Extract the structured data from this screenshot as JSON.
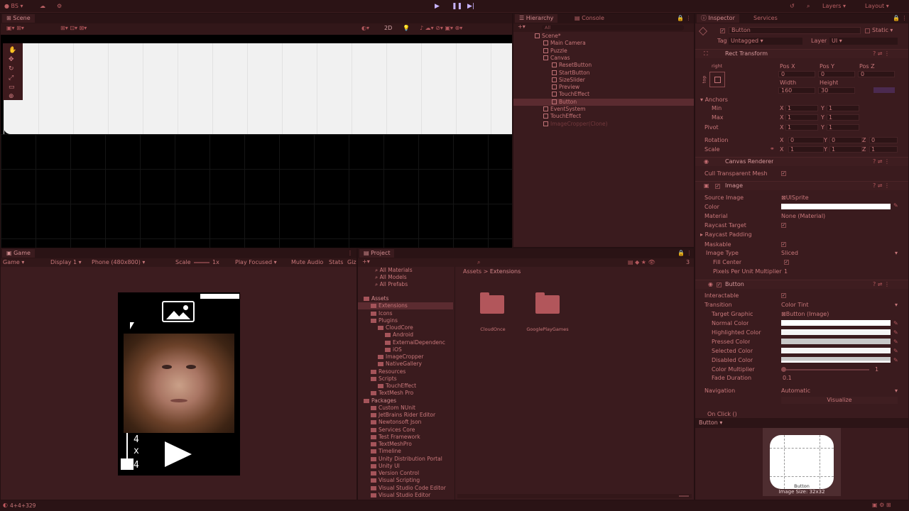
{
  "toolbar": {
    "account_label": "BS",
    "layers_label": "Layers",
    "layout_label": "Layout"
  },
  "scene": {
    "tab": "Scene",
    "mode_2d": "2D"
  },
  "hierarchy": {
    "tab": "Hierarchy",
    "console_tab": "Console",
    "search_placeholder": "All",
    "items": [
      {
        "label": "Scene*"
      },
      {
        "label": "Main Camera"
      },
      {
        "label": "Puzzle"
      },
      {
        "label": "Canvas"
      },
      {
        "label": "ResetButton"
      },
      {
        "label": "StartButton"
      },
      {
        "label": "SizeSlider"
      },
      {
        "label": "Preview"
      },
      {
        "label": "TouchEffect"
      },
      {
        "label": "Button"
      },
      {
        "label": "EventSystem"
      },
      {
        "label": "TouchEffect"
      },
      {
        "label": "ImageCropper(Clone)"
      }
    ]
  },
  "game": {
    "tab": "Game",
    "mode": "Game",
    "display": "Display 1",
    "resolution": "Phone (480x800)",
    "scale_label": "Scale",
    "scale_value": "1x",
    "play_focused": "Play Focused",
    "mute_audio": "Mute Audio",
    "stats": "Stats",
    "gizmos": "Giz",
    "counter_top": "4",
    "counter_x": "x",
    "counter_bottom": "4"
  },
  "project": {
    "tab": "Project",
    "favorites": [
      "All Materials",
      "All Models",
      "All Prefabs"
    ],
    "breadcrumb_root": "Assets",
    "breadcrumb_sep": ">",
    "breadcrumb_current": "Extensions",
    "folders_count": "3",
    "tree": [
      {
        "label": "Assets",
        "indent": 0
      },
      {
        "label": "Extensions",
        "indent": 1
      },
      {
        "label": "Icons",
        "indent": 1
      },
      {
        "label": "Plugins",
        "indent": 1
      },
      {
        "label": "CloudCore",
        "indent": 2
      },
      {
        "label": "Android",
        "indent": 3
      },
      {
        "label": "ExternalDependenc",
        "indent": 3
      },
      {
        "label": "iOS",
        "indent": 3
      },
      {
        "label": "ImageCropper",
        "indent": 2
      },
      {
        "label": "NativeGallery",
        "indent": 2
      },
      {
        "label": "Resources",
        "indent": 1
      },
      {
        "label": "Scripts",
        "indent": 1
      },
      {
        "label": "TouchEffect",
        "indent": 2
      },
      {
        "label": "TextMesh Pro",
        "indent": 1
      },
      {
        "label": "Packages",
        "indent": 0
      },
      {
        "label": "Custom NUnit",
        "indent": 1
      },
      {
        "label": "JetBrains Rider Editor",
        "indent": 1
      },
      {
        "label": "Newtonsoft Json",
        "indent": 1
      },
      {
        "label": "Services Core",
        "indent": 1
      },
      {
        "label": "Test Framework",
        "indent": 1
      },
      {
        "label": "TextMeshPro",
        "indent": 1
      },
      {
        "label": "Timeline",
        "indent": 1
      },
      {
        "label": "Unity Distribution Portal",
        "indent": 1
      },
      {
        "label": "Unity UI",
        "indent": 1
      },
      {
        "label": "Version Control",
        "indent": 1
      },
      {
        "label": "Visual Scripting",
        "indent": 1
      },
      {
        "label": "Visual Studio Code Editor",
        "indent": 1
      },
      {
        "label": "Visual Studio Editor",
        "indent": 1
      }
    ],
    "grid_folders": [
      "CloudOnce",
      "GooglePlayGames"
    ]
  },
  "inspector": {
    "tab": "Inspector",
    "services_tab": "Services",
    "object_name": "Button",
    "static_label": "Static",
    "tag_label": "Tag",
    "tag_value": "Untagged",
    "layer_label": "Layer",
    "layer_value": "UI",
    "rect_transform": {
      "title": "Rect Transform",
      "anchor_preset": "right",
      "side_label": "top",
      "pos_x_label": "Pos X",
      "pos_y_label": "Pos Y",
      "pos_z_label": "Pos Z",
      "pos_x": "0",
      "pos_y": "0",
      "pos_z": "0",
      "width_label": "Width",
      "height_label": "Height",
      "width": "160",
      "height": "30",
      "anchors_label": "Anchors",
      "min_label": "Min",
      "max_label": "Max",
      "min_x": "1",
      "min_y": "1",
      "max_x": "1",
      "max_y": "1",
      "pivot_label": "Pivot",
      "pivot_x": "1",
      "pivot_y": "1",
      "rotation_label": "Rotation",
      "rot_x": "0",
      "rot_y": "0",
      "rot_z": "0",
      "scale_label": "Scale",
      "scale_x": "1",
      "scale_y": "1",
      "scale_z": "1",
      "x": "X",
      "y": "Y",
      "z": "Z"
    },
    "canvas_renderer": {
      "title": "Canvas Renderer",
      "cull_label": "Cull Transparent Mesh"
    },
    "image": {
      "title": "Image",
      "source_label": "Source Image",
      "source_value": "UISprite",
      "color_label": "Color",
      "material_label": "Material",
      "material_value": "None (Material)",
      "raycast_target_label": "Raycast Target",
      "raycast_padding_label": "Raycast Padding",
      "maskable_label": "Maskable",
      "image_type_label": "Image Type",
      "image_type_value": "Sliced",
      "fill_center_label": "Fill Center",
      "ppu_label": "Pixels Per Unit Multiplier",
      "ppu_value": "1"
    },
    "button": {
      "title": "Button",
      "interactable_label": "Interactable",
      "transition_label": "Transition",
      "transition_value": "Color Tint",
      "target_graphic_label": "Target Graphic",
      "target_graphic_value": "Button (Image)",
      "normal_label": "Normal Color",
      "highlighted_label": "Highlighted Color",
      "pressed_label": "Pressed Color",
      "selected_label": "Selected Color",
      "disabled_label": "Disabled Color",
      "multiplier_label": "Color Multiplier",
      "multiplier_value": "1",
      "fade_label": "Fade Duration",
      "fade_value": "0.1",
      "navigation_label": "Navigation",
      "navigation_value": "Automatic",
      "visualize_label": "Visualize",
      "onclick_label": "On Click ()"
    },
    "preview": {
      "title": "Button",
      "name": "Button",
      "size": "Image Size: 32x32"
    }
  },
  "status": {
    "text": "4+4+329"
  }
}
